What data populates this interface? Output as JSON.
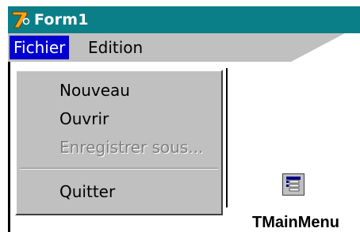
{
  "window": {
    "title": "Form1",
    "icon": "delphi-logo-icon",
    "title_bar_color": "#0b7f87"
  },
  "menubar": {
    "items": [
      {
        "label": "Fichier",
        "active": true
      },
      {
        "label": "Edition",
        "active": false
      }
    ],
    "active_color": "#0000d0"
  },
  "dropdown": {
    "items": [
      {
        "label": "Nouveau",
        "enabled": true
      },
      {
        "label": "Ouvrir",
        "enabled": true
      },
      {
        "label": "Enregistrer sous...",
        "enabled": false
      },
      {
        "label": "Quitter",
        "enabled": true
      }
    ]
  },
  "component": {
    "name": "TMainMenu",
    "icon": "main-menu-component-icon"
  }
}
